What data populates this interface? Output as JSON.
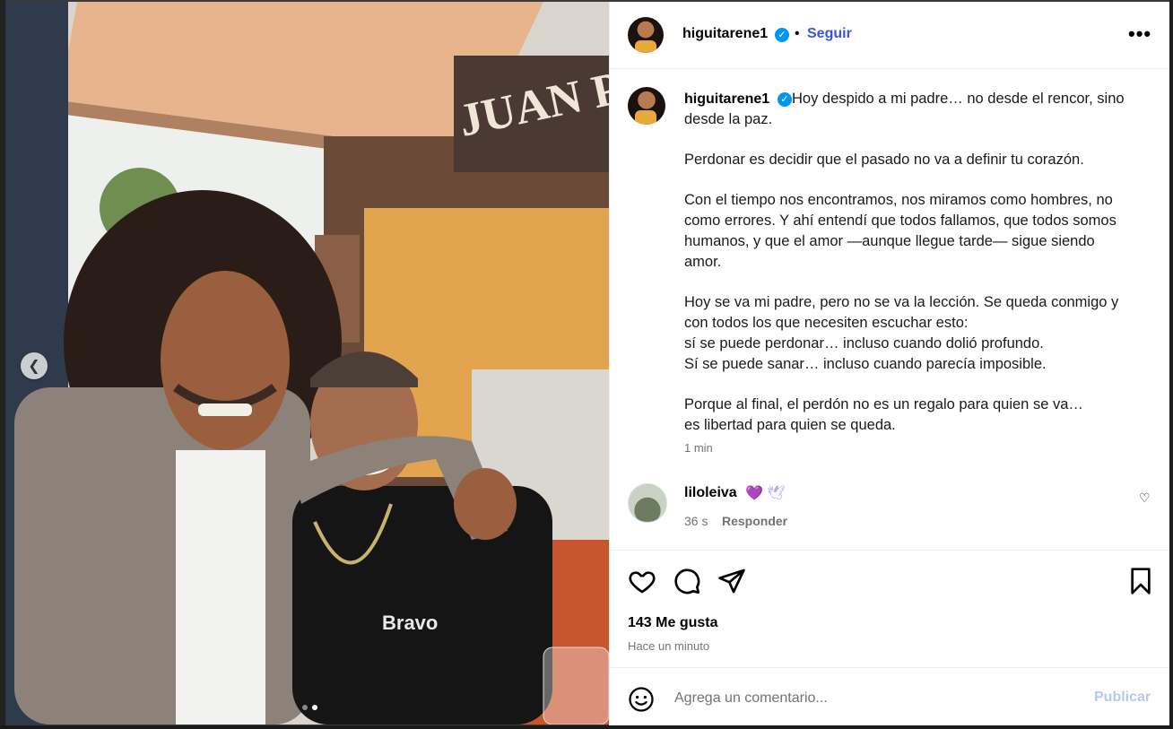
{
  "post": {
    "username": "higuitarene1",
    "separator": "•",
    "follow_label": "Seguir",
    "more_label": "•••"
  },
  "caption": {
    "username": "higuitarene1",
    "p1": "Hoy despido a mi padre… no desde el rencor, sino desde la paz.",
    "p2": "Perdonar es decidir que el pasado no va a definir tu corazón.",
    "p3": "Con el tiempo nos encontramos, nos miramos como hombres, no como errores. Y ahí entendí que todos fallamos, que todos somos humanos, y que el amor —aunque llegue tarde— sigue siendo amor.",
    "p4_l1": "Hoy se va mi padre, pero no se va la lección. Se queda conmigo y con todos los que necesiten escuchar esto:",
    "p4_l2": "sí se puede perdonar… incluso cuando dolió profundo.",
    "p4_l3": "Sí se puede sanar… incluso cuando parecía imposible.",
    "p5_l1": "Porque al final, el perdón no es un regalo para quien se va…",
    "p5_l2": "es libertad para quien se queda.",
    "time": "1 min"
  },
  "comment": {
    "username": "liloleiva",
    "emoji": "💜 🕊",
    "time": "36 s",
    "reply_label": "Responder"
  },
  "actions": {
    "likes": "143 Me gusta",
    "ago": "Hace un minuto"
  },
  "composer": {
    "placeholder": "Agrega un comentario...",
    "publish_label": "Publicar"
  },
  "photo": {
    "sign_text": "JUAN PA",
    "shirt_text": "Bravo"
  },
  "colors": {
    "verified": "#0095f6",
    "follow": "#3c52e0",
    "publish_disabled": "#b3c9f4"
  }
}
